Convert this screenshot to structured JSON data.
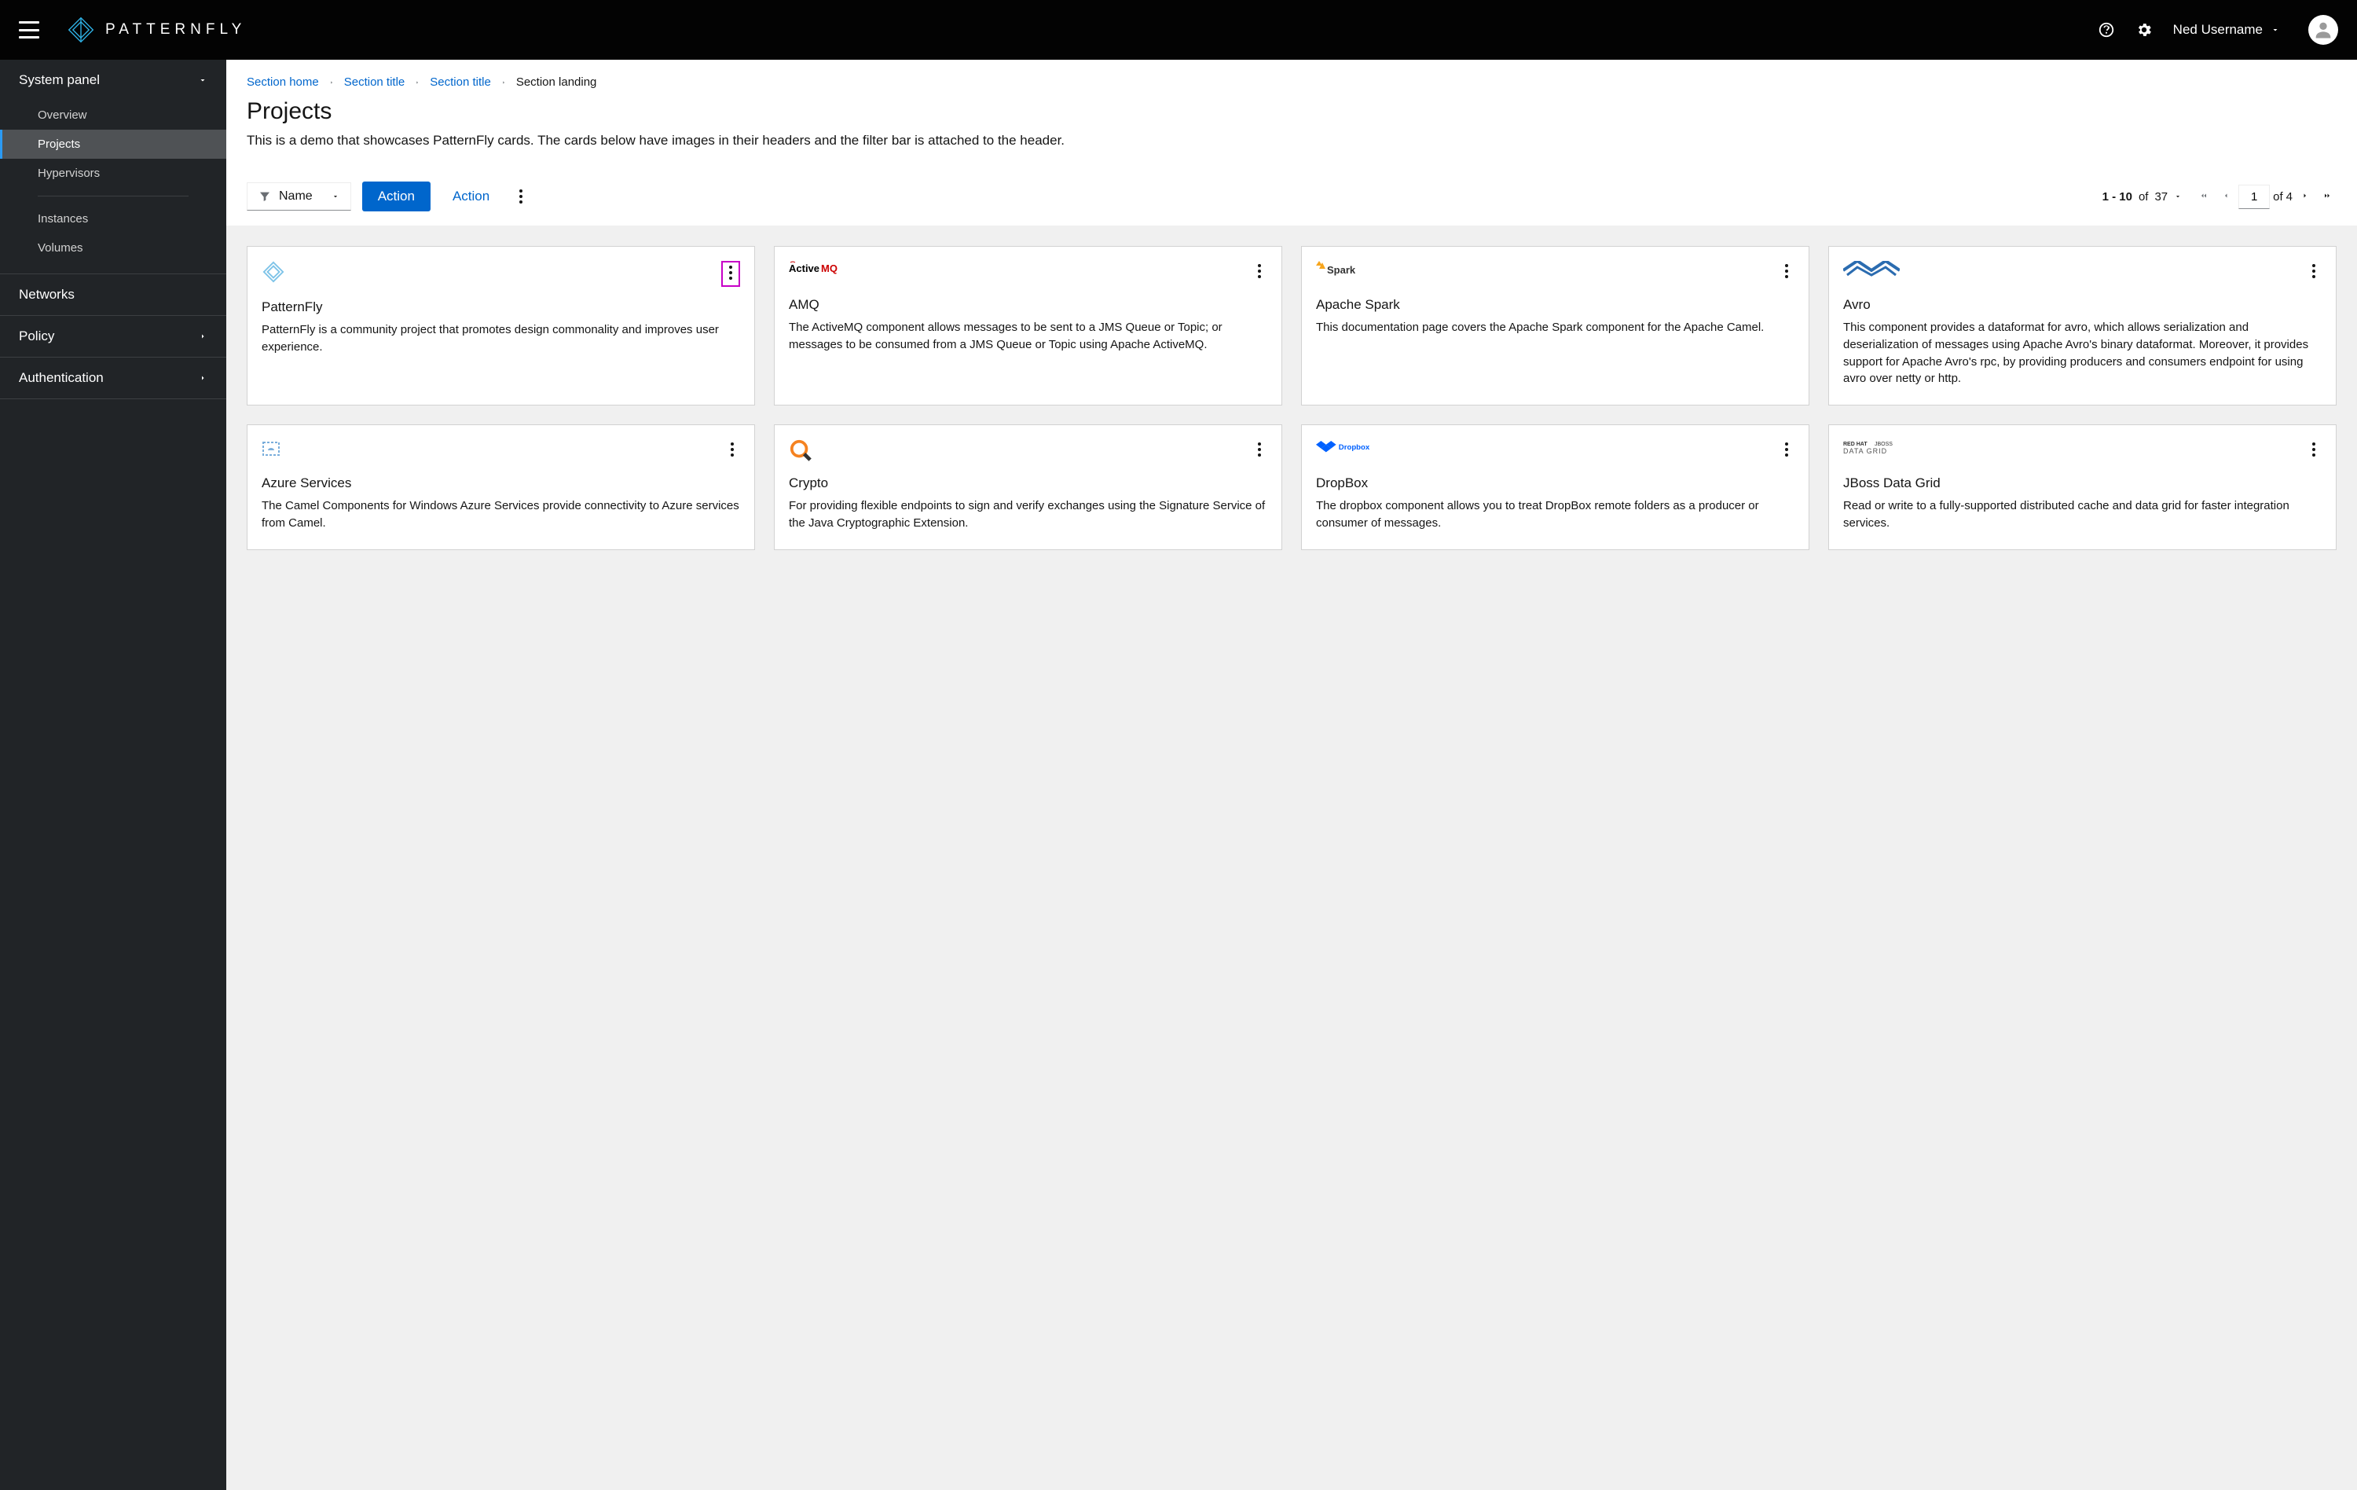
{
  "brand": {
    "text": "PATTERNFLY"
  },
  "user": {
    "name": "Ned Username"
  },
  "sidebar": {
    "sections": [
      {
        "label": "System panel",
        "expanded": true,
        "items": [
          {
            "label": "Overview"
          },
          {
            "label": "Projects",
            "current": true
          },
          {
            "label": "Hypervisors"
          }
        ],
        "items2": [
          {
            "label": "Instances"
          },
          {
            "label": "Volumes"
          }
        ]
      },
      {
        "label": "Networks",
        "expandable": false
      },
      {
        "label": "Policy",
        "expandable": true
      },
      {
        "label": "Authentication",
        "expandable": true
      }
    ]
  },
  "breadcrumb": {
    "items": [
      {
        "label": "Section home"
      },
      {
        "label": "Section title"
      },
      {
        "label": "Section title"
      }
    ],
    "current": "Section landing"
  },
  "page": {
    "title": "Projects",
    "desc": "This is a demo that showcases PatternFly cards. The cards below have images in their headers and the filter bar is attached to the header."
  },
  "toolbar": {
    "filter_label": "Name",
    "primary_action": "Action",
    "secondary_action": "Action",
    "pagination": {
      "range": "1 - 10",
      "of_label": "of",
      "total": "37",
      "page": "1",
      "pages": "4"
    }
  },
  "cards": [
    {
      "title": "PatternFly",
      "body": "PatternFly is a community project that promotes design commonality and improves user experience.",
      "logo": "patternfly",
      "highlight_kebab": true
    },
    {
      "title": "AMQ",
      "body": "The ActiveMQ component allows messages to be sent to a JMS Queue or Topic; or messages to be consumed from a JMS Queue or Topic using Apache ActiveMQ.",
      "logo": "activemq"
    },
    {
      "title": "Apache Spark",
      "body": "This documentation page covers the Apache Spark component for the Apache Camel.",
      "logo": "spark"
    },
    {
      "title": "Avro",
      "body": "This component provides a dataformat for avro, which allows serialization and deserialization of messages using Apache Avro's binary dataformat. Moreover, it provides support for Apache Avro's rpc, by providing producers and consumers endpoint for using avro over netty or http.",
      "logo": "avro"
    },
    {
      "title": "Azure Services",
      "body": "The Camel Components for Windows Azure Services provide connectivity to Azure services from Camel.",
      "logo": "azure"
    },
    {
      "title": "Crypto",
      "body": "For providing flexible endpoints to sign and verify exchanges using the Signature Service of the Java Cryptographic Extension.",
      "logo": "crypto"
    },
    {
      "title": "DropBox",
      "body": "The dropbox component allows you to treat DropBox remote folders as a producer or consumer of messages.",
      "logo": "dropbox"
    },
    {
      "title": "JBoss Data Grid",
      "body": "Read or write to a fully-supported distributed cache and data grid for faster integration services.",
      "logo": "jboss"
    }
  ]
}
